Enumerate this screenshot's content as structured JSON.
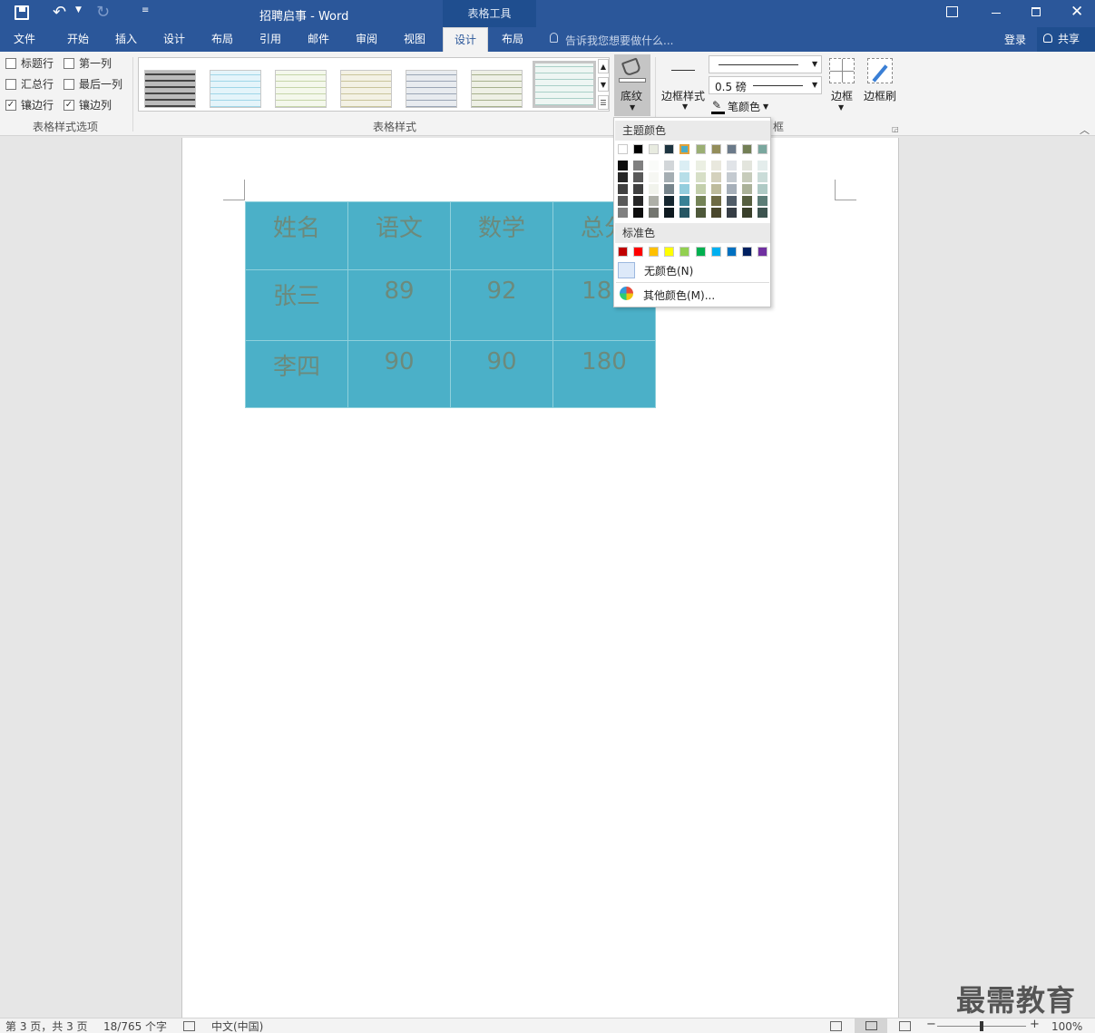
{
  "title_bar": {
    "document_title": "招聘启事 - Word",
    "context_tab_group": "表格工具"
  },
  "tabs": [
    {
      "label": "文件"
    },
    {
      "label": "开始"
    },
    {
      "label": "插入"
    },
    {
      "label": "设计"
    },
    {
      "label": "布局"
    },
    {
      "label": "引用"
    },
    {
      "label": "邮件"
    },
    {
      "label": "审阅"
    },
    {
      "label": "视图"
    },
    {
      "label": "设计"
    },
    {
      "label": "布局"
    }
  ],
  "tell_me": "告诉我您想要做什么...",
  "login": "登录",
  "share": "共享",
  "ribbon": {
    "style_options": {
      "group_label": "表格样式选项",
      "items": [
        {
          "label": "标题行",
          "checked": false
        },
        {
          "label": "第一列",
          "checked": false
        },
        {
          "label": "汇总行",
          "checked": false
        },
        {
          "label": "最后一列",
          "checked": false
        },
        {
          "label": "镶边行",
          "checked": true
        },
        {
          "label": "镶边列",
          "checked": true
        }
      ]
    },
    "table_styles": {
      "group_label": "表格样式"
    },
    "shading_label": "底纹",
    "border_styles_label": "边框样式",
    "border_weight": "0.5 磅",
    "pen_color_label": "笔颜色",
    "borders_label": "边框",
    "border_painter_label": "边框刷",
    "borders_group_label": "框"
  },
  "table": {
    "headers": [
      "姓名",
      "语文",
      "数学",
      "总分"
    ],
    "rows": [
      [
        "张三",
        "89",
        "92",
        "181"
      ],
      [
        "李四",
        "90",
        "90",
        "180"
      ]
    ]
  },
  "dropdown": {
    "theme_colors_label": "主题颜色",
    "standard_colors_label": "标准色",
    "no_color": "无颜色(N)",
    "more_colors": "其他颜色(M)...",
    "theme_colors": [
      "#ffffff",
      "#000000",
      "#e8ebe0",
      "#1d3440",
      "#4bacc6",
      "#9baf74",
      "#938d5a",
      "#6b7a8a",
      "#737f55",
      "#7aa79e"
    ],
    "standard_colors": [
      "#c00000",
      "#ff0000",
      "#ffc000",
      "#ffff00",
      "#92d050",
      "#00b050",
      "#00b0f0",
      "#0070c0",
      "#002060",
      "#7030a0"
    ]
  },
  "status_bar": {
    "page": "第 3 页，共 3 页",
    "words": "18/765 个字",
    "language": "中文(中国)",
    "zoom": "100%"
  },
  "watermark": "最需教育"
}
